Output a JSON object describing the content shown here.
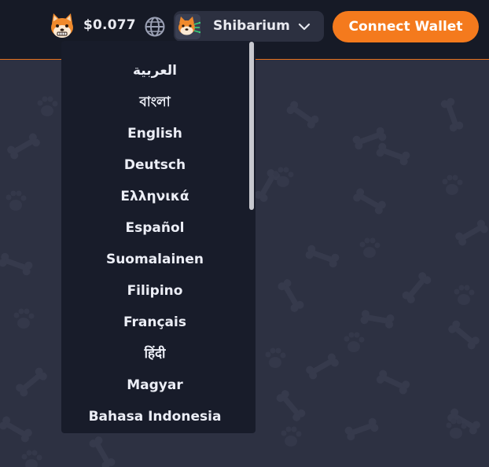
{
  "header": {
    "price": "$0.077",
    "network_label": "Shibarium",
    "connect_label": "Connect Wallet"
  },
  "language_menu": {
    "items": [
      "العربية",
      "বাংলা",
      "English",
      "Deutsch",
      "Ελληνικά",
      "Español",
      "Suomalainen",
      "Filipino",
      "Français",
      "हिंदी",
      "Magyar",
      "Bahasa Indonesia"
    ]
  },
  "colors": {
    "accent": "#f47a1d",
    "header_bg": "#161a26",
    "page_bg": "#2d3142",
    "menu_bg": "#181c2a"
  },
  "icons": {
    "token": "shiba-inu-dog-icon",
    "language": "globe-icon",
    "network": "shiba-network-icon",
    "dropdown": "chevron-down-icon"
  }
}
